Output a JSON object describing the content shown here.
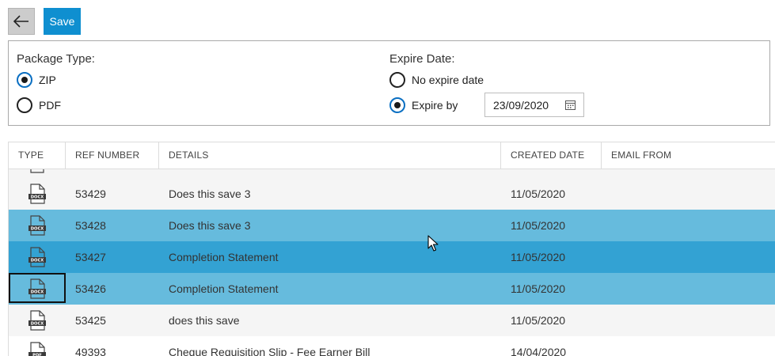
{
  "toolbar": {
    "save_label": "Save",
    "back_icon": "arrow-left-icon"
  },
  "options": {
    "package_type_label": "Package Type:",
    "package_types": [
      {
        "label": "ZIP",
        "checked": true
      },
      {
        "label": "PDF",
        "checked": false
      }
    ],
    "expire_label": "Expire Date:",
    "expire_options": [
      {
        "label": "No expire date",
        "checked": false
      },
      {
        "label": "Expire by",
        "checked": true
      }
    ],
    "expire_date_value": "23/09/2020"
  },
  "grid": {
    "columns": [
      "TYPE",
      "REF NUMBER",
      "DETAILS",
      "CREATED DATE",
      "EMAIL FROM"
    ],
    "rows": [
      {
        "type": "DOCX",
        "ref": "53429",
        "details": "Does this save 3",
        "created": "11/05/2020",
        "email": ""
      },
      {
        "type": "DOCX",
        "ref": "53428",
        "details": "Does this save 3",
        "created": "11/05/2020",
        "email": ""
      },
      {
        "type": "DOCX",
        "ref": "53427",
        "details": "Completion Statement",
        "created": "11/05/2020",
        "email": ""
      },
      {
        "type": "DOCX",
        "ref": "53426",
        "details": "Completion Statement",
        "created": "11/05/2020",
        "email": ""
      },
      {
        "type": "DOCX",
        "ref": "53425",
        "details": "does this save",
        "created": "11/05/2020",
        "email": ""
      },
      {
        "type": "PDF",
        "ref": "49393",
        "details": "Cheque Requisition Slip - Fee Earner Bill",
        "created": "14/04/2020",
        "email": ""
      }
    ]
  },
  "colors": {
    "accent": "#0f8fd0",
    "row_selected": "#66bbdd",
    "row_selected_strong": "#33a2d3"
  }
}
